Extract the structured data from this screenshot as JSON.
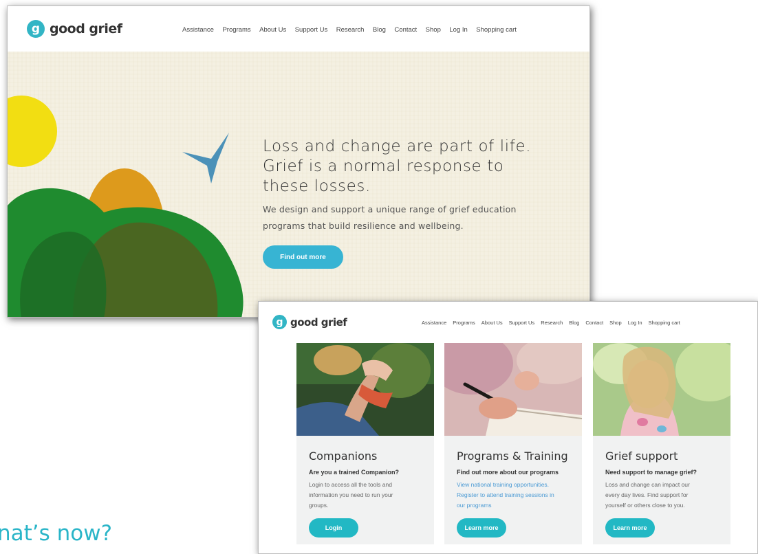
{
  "brand": {
    "logo_letter": "g",
    "logo_text": "good grief",
    "accent": "#32b5c5"
  },
  "nav": [
    "Assistance",
    "Programs",
    "About Us",
    "Support Us",
    "Research",
    "Blog",
    "Contact",
    "Shop",
    "Log In",
    "Shopping cart"
  ],
  "hero": {
    "heading": [
      "Loss and change are part of life.",
      "Grief is a normal response to",
      "these losses."
    ],
    "body": [
      "We design and support a unique range of grief education",
      "programs that build resilience and wellbeing."
    ],
    "button": "Find out more",
    "button_color": "#37b4d3"
  },
  "cards": [
    {
      "title": "Companions",
      "subtitle": "Are you a trained Companion?",
      "body": [
        "Login to access all the tools and",
        "information you need to run your",
        "groups."
      ],
      "link_style": false,
      "button": "Login"
    },
    {
      "title": "Programs & Training",
      "subtitle": "Find out more about our programs",
      "body": [
        "View national training opportunities.",
        "Register to attend training sessions in",
        "our programs"
      ],
      "link_style": true,
      "button": "Learn more"
    },
    {
      "title": "Grief support",
      "subtitle": "Need support to manage grief?",
      "body": [
        "Loss and change can impact our",
        "every day lives. Find support for",
        "yourself or others close to you."
      ],
      "link_style": false,
      "button": "Learn more"
    }
  ],
  "slide_title": "nat’s now?"
}
